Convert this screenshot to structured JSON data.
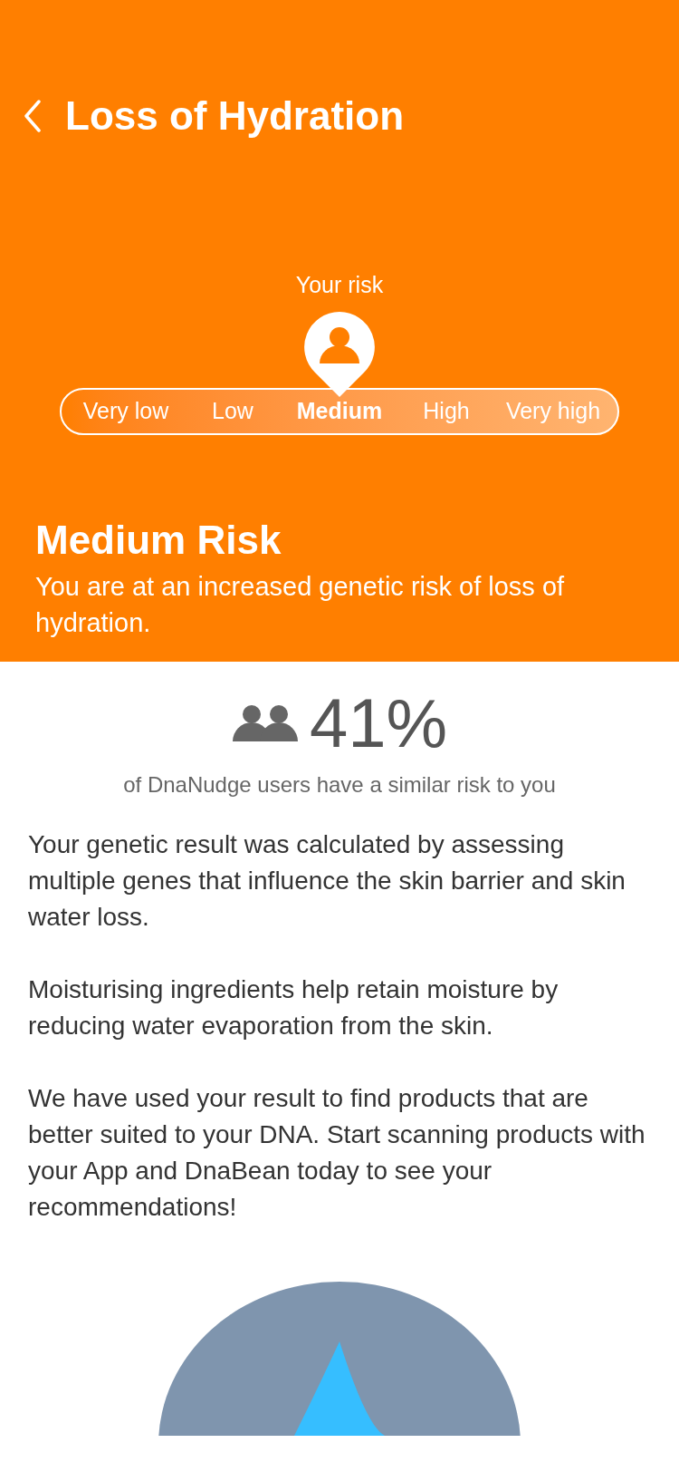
{
  "header": {
    "title": "Loss of Hydration"
  },
  "risk_scale": {
    "label": "Your risk",
    "levels": [
      {
        "label": "Very low",
        "selected": false
      },
      {
        "label": "Low",
        "selected": false
      },
      {
        "label": "Medium",
        "selected": true
      },
      {
        "label": "High",
        "selected": false
      },
      {
        "label": "Very high",
        "selected": false
      }
    ]
  },
  "result": {
    "title": "Medium Risk",
    "description": "You are at an increased genetic risk of loss of hydration."
  },
  "stat": {
    "value": "41%",
    "caption": "of DnaNudge users have a similar risk to you"
  },
  "paragraphs": [
    "Your genetic result was calculated by assessing multiple genes that influence the skin barrier and skin water loss.",
    "Moisturising ingredients help retain moisture by reducing water evaporation from the skin.",
    "We have used your result to find products that are better suited to your DNA. Start scanning products with your App and DnaBean today to see your recommendations!"
  ]
}
